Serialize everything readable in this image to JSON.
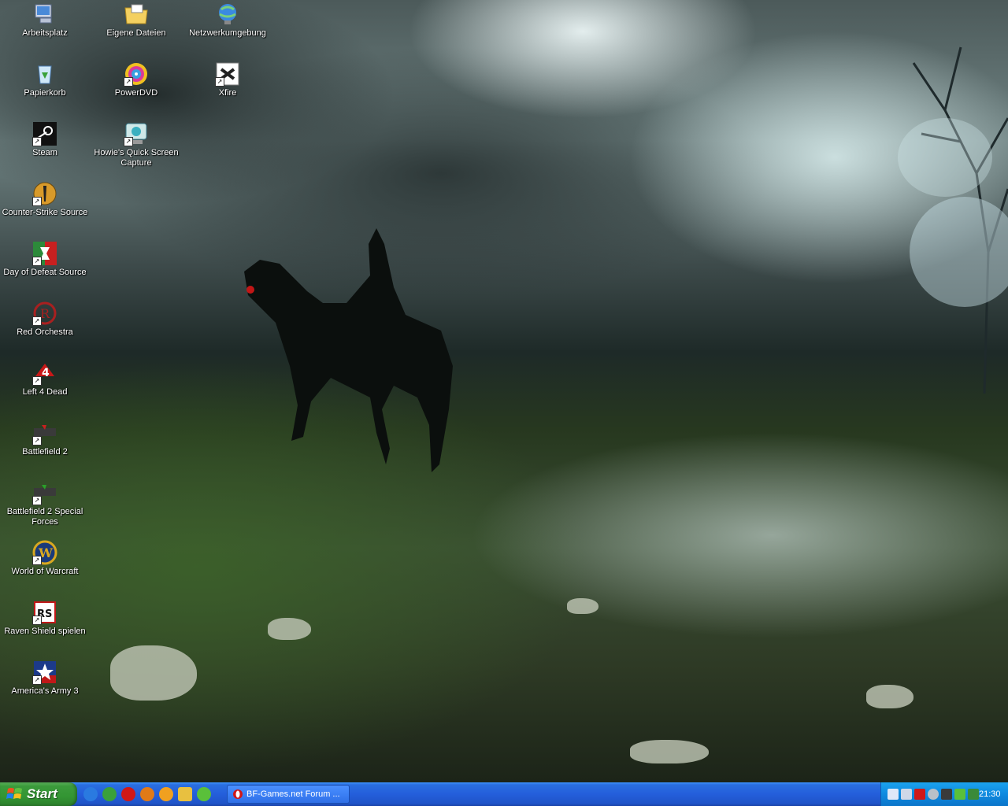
{
  "desktop": {
    "icons": [
      {
        "label": "Arbeitsplatz",
        "icon": "computer-icon",
        "shortcut": false
      },
      {
        "label": "Eigene Dateien",
        "icon": "folder-icon",
        "shortcut": false
      },
      {
        "label": "Netzwerkumgebung",
        "icon": "network-icon",
        "shortcut": false
      },
      {
        "label": "Papierkorb",
        "icon": "recycle-bin-icon",
        "shortcut": false
      },
      {
        "label": "PowerDVD",
        "icon": "powerdvd-icon",
        "shortcut": true
      },
      {
        "label": "Xfire",
        "icon": "xfire-icon",
        "shortcut": true
      },
      {
        "label": "Steam",
        "icon": "steam-icon",
        "shortcut": true
      },
      {
        "label": "Howie's Quick Screen Capture",
        "icon": "screen-capture-icon",
        "shortcut": true
      },
      {
        "label": "Counter-Strike Source",
        "icon": "counter-strike-icon",
        "shortcut": true
      },
      {
        "label": "Day of Defeat Source",
        "icon": "day-of-defeat-icon",
        "shortcut": true
      },
      {
        "label": "Red Orchestra",
        "icon": "red-orchestra-icon",
        "shortcut": true
      },
      {
        "label": "Left 4 Dead",
        "icon": "left4dead-icon",
        "shortcut": true
      },
      {
        "label": "Battlefield 2",
        "icon": "battlefield2-icon",
        "shortcut": true
      },
      {
        "label": "Battlefield 2 Special Forces",
        "icon": "battlefield2-sf-icon",
        "shortcut": true
      },
      {
        "label": "World of Warcraft",
        "icon": "wow-icon",
        "shortcut": true
      },
      {
        "label": "Raven Shield spielen",
        "icon": "raven-shield-icon",
        "shortcut": true
      },
      {
        "label": "America's Army 3",
        "icon": "americas-army-icon",
        "shortcut": true
      }
    ]
  },
  "taskbar": {
    "start_label": "Start",
    "quick_launch": [
      "ie-icon",
      "messenger-icon",
      "opera-icon",
      "firefox-icon",
      "media-player-icon",
      "winamp-icon",
      "icq-icon"
    ],
    "tasks": [
      {
        "label": "BF-Games.net Forum ...",
        "icon": "opera-icon"
      }
    ],
    "tray": {
      "icons": [
        "network-tray-icon",
        "volume-tray-icon",
        "antivirus-tray-icon",
        "update-tray-icon",
        "steam-tray-icon",
        "icq-tray-icon",
        "messenger-tray-icon"
      ],
      "clock": "21:30"
    }
  },
  "colors": {
    "taskbar_blue": "#245edb",
    "start_green": "#339533",
    "tray_blue": "#0f8ae0"
  }
}
